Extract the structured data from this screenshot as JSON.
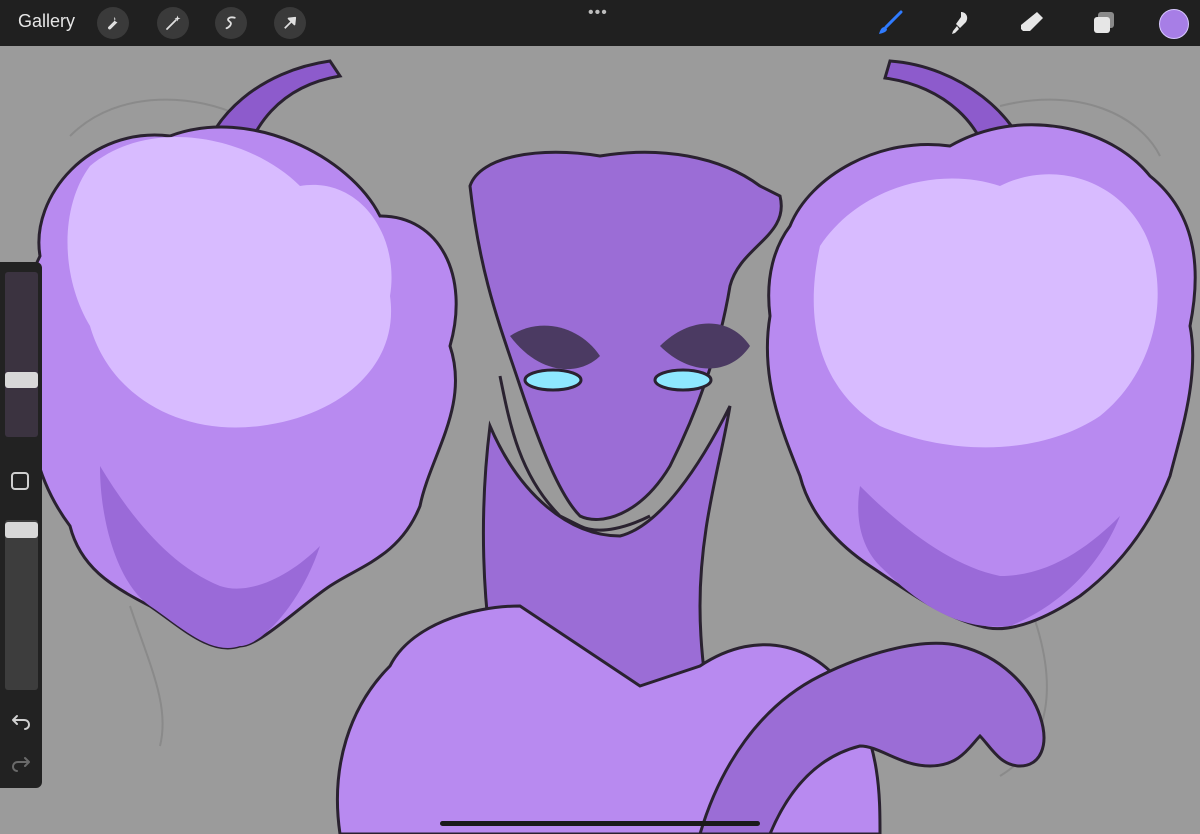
{
  "toolbar": {
    "gallery_label": "Gallery",
    "left_tools": [
      "wrench-icon",
      "magic-wand-icon",
      "selection-icon",
      "transform-arrow-icon"
    ],
    "more_dots": "•••",
    "right_tools": [
      "brush-icon",
      "smudge-icon",
      "eraser-icon",
      "layers-icon"
    ],
    "active_color": "#a77ee6"
  },
  "sidebar": {
    "brush_size_level": 0.65,
    "opacity_level": 0.94,
    "modify_button": "square-icon",
    "undo": "undo-icon",
    "redo": "redo-icon"
  },
  "colors": {
    "canvas_background": "#9b9b9b",
    "dragon_body": "#9b6dd6",
    "fur_light": "#d8bbff",
    "fur_mid": "#b88af0",
    "fur_dark": "#9a6ad8",
    "eye": "#8ee8ff",
    "toolbar": "#202020"
  }
}
